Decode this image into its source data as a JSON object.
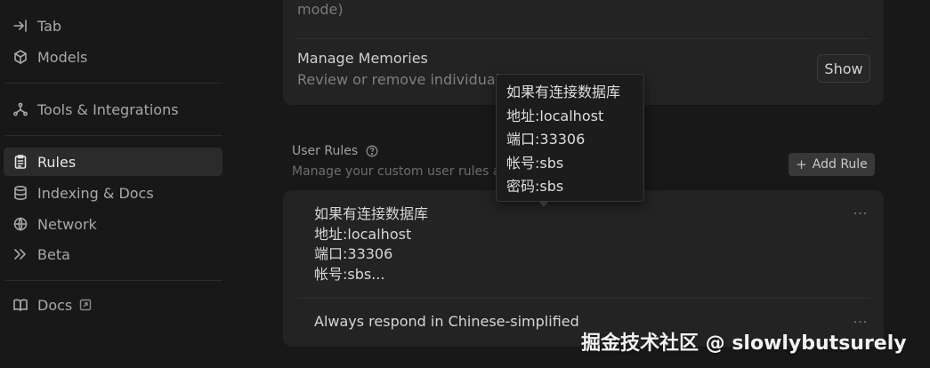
{
  "sidebar": {
    "items": [
      {
        "label": "Tab",
        "icon": "tab-arrow-icon"
      },
      {
        "label": "Models",
        "icon": "cube-icon"
      },
      {
        "label": "Tools & Integrations",
        "icon": "tools-icon"
      },
      {
        "label": "Rules",
        "icon": "clipboard-icon",
        "active": true
      },
      {
        "label": "Indexing & Docs",
        "icon": "database-icon"
      },
      {
        "label": "Network",
        "icon": "globe-icon"
      },
      {
        "label": "Beta",
        "icon": "chevrons-right-icon"
      },
      {
        "label": "Docs",
        "icon": "book-icon",
        "external": true
      }
    ]
  },
  "memories_card": {
    "top_text": "mode)",
    "manage_title": "Manage Memories",
    "manage_desc": "Review or remove individual M",
    "show_button": "Show"
  },
  "user_rules": {
    "title": "User Rules",
    "description": "Manage your custom user rules and",
    "add_button": "Add Rule",
    "rules": [
      {
        "lines": [
          "如果有连接数据库",
          "地址:localhost",
          "端口:33306",
          "帐号:sbs..."
        ]
      },
      {
        "lines": [
          "Always respond in Chinese-simplified"
        ]
      }
    ],
    "more_label": "···"
  },
  "tooltip": {
    "lines": [
      "如果有连接数据库",
      "地址:localhost",
      "端口:33306",
      "帐号:sbs",
      "密码:sbs"
    ]
  },
  "watermark": "掘金技术社区 @ slowlybutsurely",
  "colors": {
    "background": "#181818",
    "card": "#232323",
    "active_item": "#2b2b2b"
  }
}
